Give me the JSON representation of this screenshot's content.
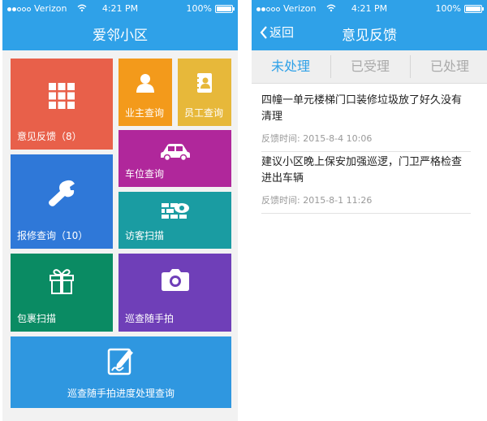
{
  "status": {
    "carrier": "Verizon",
    "time": "4:21 PM",
    "battery": "100%"
  },
  "left": {
    "title": "爱邻小区",
    "tiles": {
      "feedback": "意见反馈（8）",
      "owner": "业主查询",
      "staff": "员工查询",
      "parking": "车位查询",
      "repair": "报修查询（10）",
      "visitor": "访客扫描",
      "parcel": "包裹扫描",
      "patrol": "巡查随手拍",
      "progress": "巡查随手拍进度处理查询"
    }
  },
  "right": {
    "back": "返回",
    "title": "意见反馈",
    "tabs": [
      "未处理",
      "已受理",
      "已处理"
    ],
    "items": [
      {
        "text": "四幢一单元楼梯门口装修垃圾放了好久没有清理",
        "time_label": "反馈时间:",
        "time": "2015-8-4  10:06"
      },
      {
        "text": "建议小区晚上保安加强巡逻，门卫严格检查进出车辆",
        "time_label": "反馈时间:",
        "time": "2015-8-1  11:26"
      }
    ]
  },
  "colors": {
    "header": "#2fa1e8",
    "feedback": "#e8604a",
    "owner": "#f39a1b",
    "staff": "#e7b83a",
    "parking": "#b0279b",
    "repair": "#2f78d8",
    "visitor": "#1a9ca2",
    "parcel": "#0a8b63",
    "patrol": "#6f3fb8",
    "progress": "#2f97e0"
  }
}
